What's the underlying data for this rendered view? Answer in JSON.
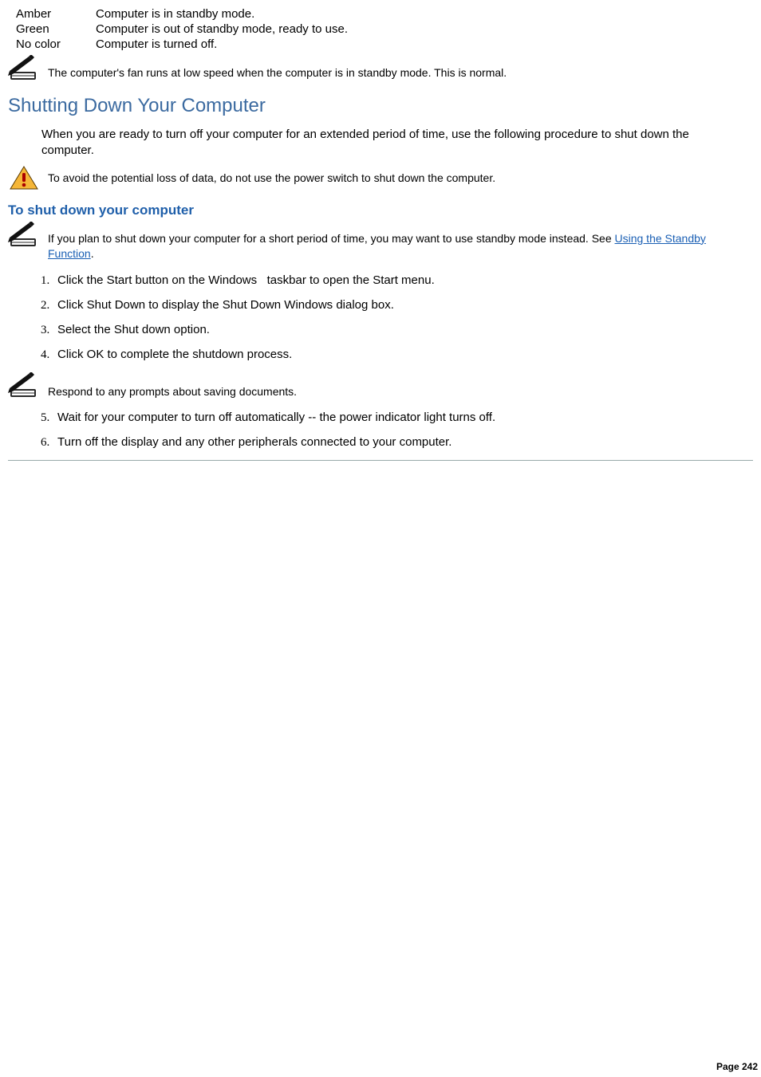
{
  "status_rows": [
    {
      "label": "Amber",
      "desc": "Computer is in standby mode."
    },
    {
      "label": "Green",
      "desc": "Computer is out of standby mode, ready to use."
    },
    {
      "label": "No color",
      "desc": "Computer is turned off."
    }
  ],
  "note_fan": "The computer's fan runs at low speed when the computer is in standby mode. This is normal.",
  "heading_shutdown": "Shutting Down Your Computer",
  "para_intro": "When you are ready to turn off your computer for an extended period of time, use the following procedure to shut down the computer.",
  "warn_text": "To avoid the potential loss of data, do not use the power switch to shut down the computer.",
  "subheading": "To shut down your computer",
  "shutdown_note_pre": "If you plan to shut down your computer for a short period of time, you may want to use standby mode instead. See ",
  "shutdown_note_link": "Using the Standby Function",
  "shutdown_note_post": ".",
  "steps_a": [
    "Click the Start button on the Windows   taskbar to open the Start menu.",
    "Click Shut Down to display the Shut Down Windows dialog box.",
    "Select the Shut down option.",
    "Click OK to complete the shutdown process."
  ],
  "mid_note": "Respond to any prompts about saving documents.",
  "steps_b": [
    "Wait for your computer to turn off automatically -- the power indicator light turns off.",
    "Turn off the display and any other peripherals connected to your computer."
  ],
  "page_number": "Page 242"
}
